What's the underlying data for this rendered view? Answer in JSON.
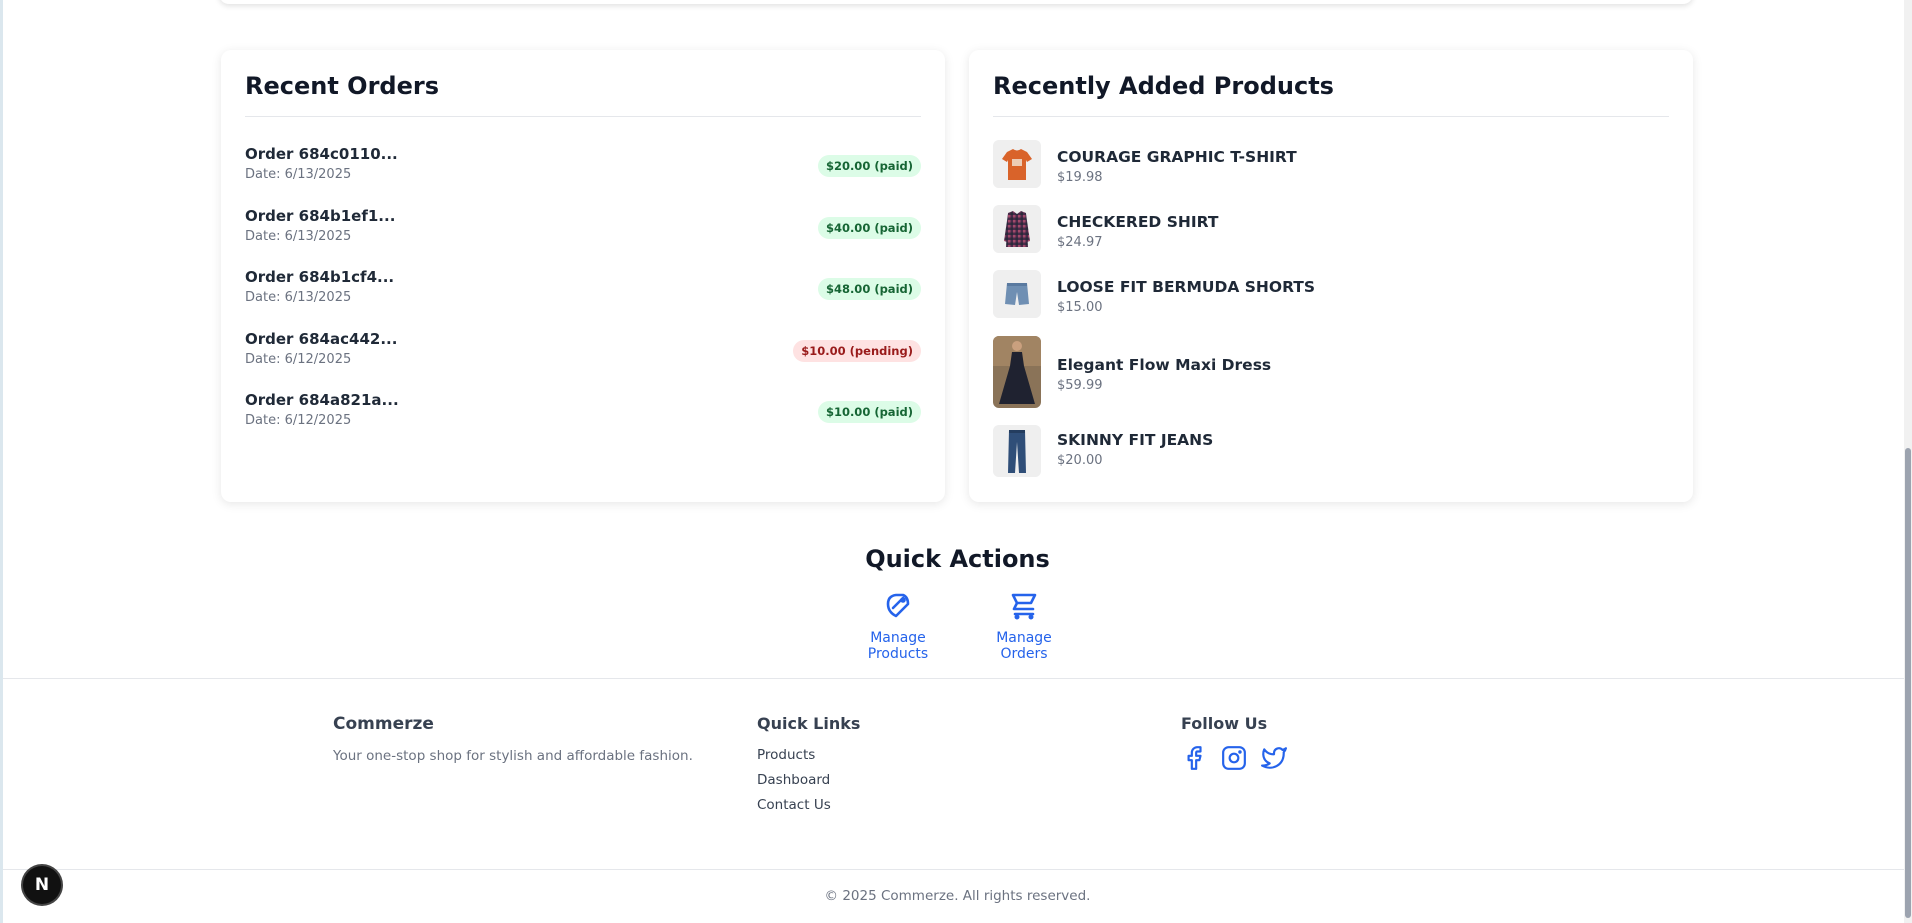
{
  "recent_orders": {
    "title": "Recent Orders",
    "orders": [
      {
        "name": "Order 684c0110...",
        "date": "Date: 6/13/2025",
        "status": "$20.00 (paid)",
        "kind": "paid"
      },
      {
        "name": "Order 684b1ef1...",
        "date": "Date: 6/13/2025",
        "status": "$40.00 (paid)",
        "kind": "paid"
      },
      {
        "name": "Order 684b1cf4...",
        "date": "Date: 6/13/2025",
        "status": "$48.00 (paid)",
        "kind": "paid"
      },
      {
        "name": "Order 684ac442...",
        "date": "Date: 6/12/2025",
        "status": "$10.00 (pending)",
        "kind": "pending"
      },
      {
        "name": "Order 684a821a...",
        "date": "Date: 6/12/2025",
        "status": "$10.00 (paid)",
        "kind": "paid"
      }
    ]
  },
  "recent_products": {
    "title": "Recently Added Products",
    "products": [
      {
        "name": "COURAGE GRAPHIC T-SHIRT",
        "price": "$19.98",
        "image": "orange-tshirt"
      },
      {
        "name": "CHECKERED SHIRT",
        "price": "$24.97",
        "image": "checkered-shirt"
      },
      {
        "name": "LOOSE FIT BERMUDA SHORTS",
        "price": "$15.00",
        "image": "denim-shorts"
      },
      {
        "name": "Elegant Flow Maxi Dress",
        "price": "$59.99",
        "image": "black-maxi-dress"
      },
      {
        "name": "SKINNY FIT JEANS",
        "price": "$20.00",
        "image": "blue-jeans"
      }
    ]
  },
  "quick_actions": {
    "title": "Quick Actions",
    "manage_products": "Manage Products",
    "manage_orders": "Manage Orders"
  },
  "footer": {
    "brand": "Commerze",
    "tagline": "Your one-stop shop for stylish and affordable fashion.",
    "quick_links_title": "Quick Links",
    "links": [
      "Products",
      "Dashboard",
      "Contact Us"
    ],
    "follow_title": "Follow Us",
    "social": [
      "facebook-icon",
      "instagram-icon",
      "twitter-icon"
    ],
    "copyright": "© 2025 Commerze. All rights reserved."
  },
  "dev_badge": "N",
  "colors": {
    "accent": "#2563eb",
    "paid_bg": "#dcfce7",
    "paid_text": "#166534",
    "pending_bg": "#fee2e2",
    "pending_text": "#991b1b"
  }
}
